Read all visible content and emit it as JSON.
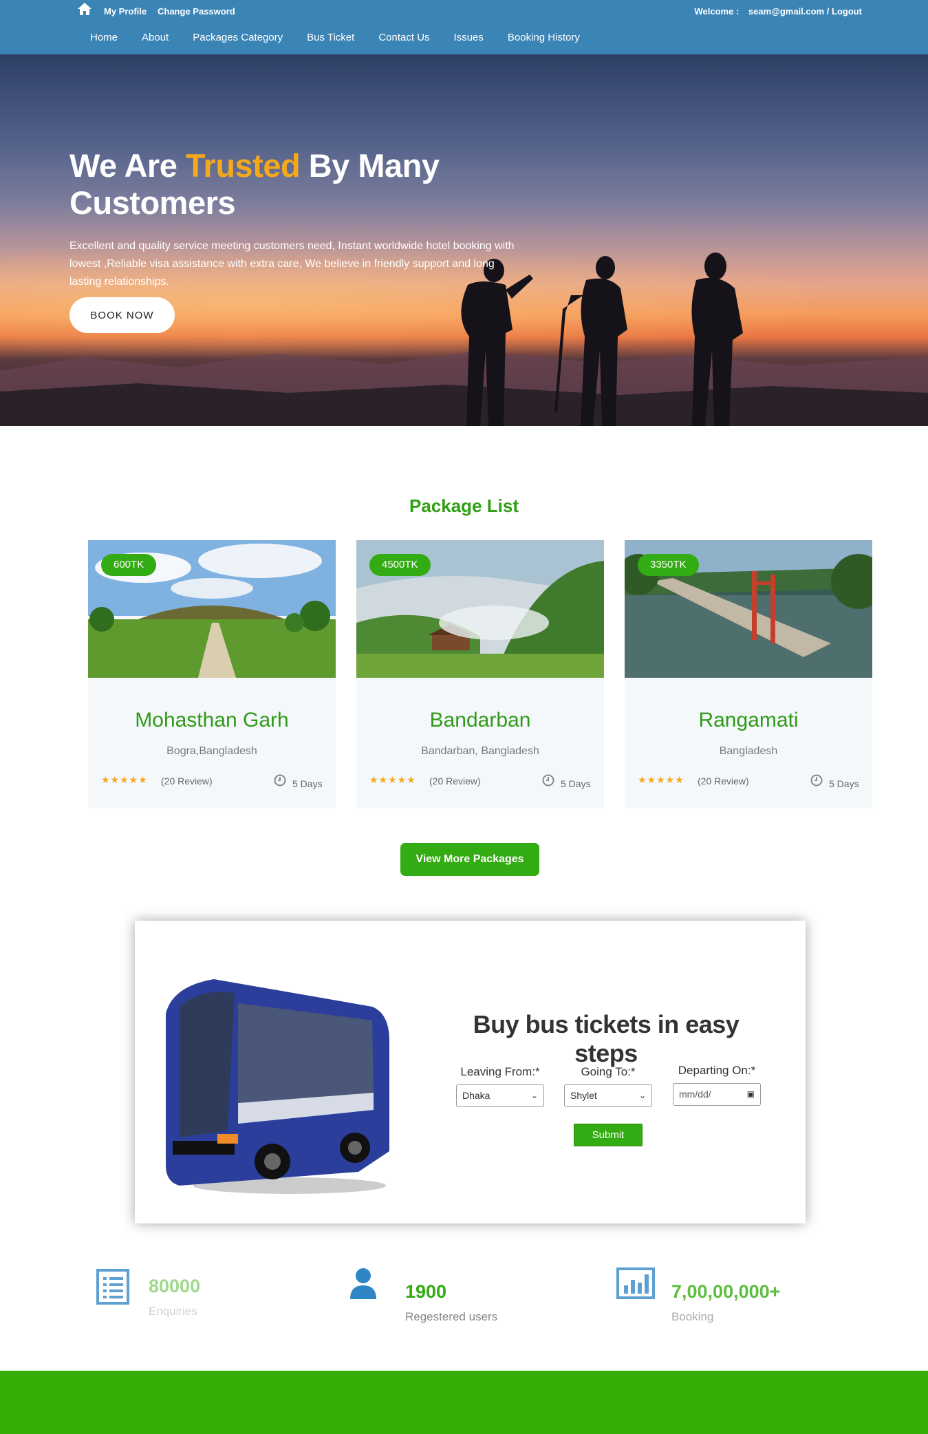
{
  "header": {
    "top_links": [
      "My Profile",
      "Change Password"
    ],
    "welcome_label": "Welcome :",
    "welcome_user": "seam@gmail.com / Logout",
    "nav": [
      "Home",
      "About",
      "Packages Category",
      "Bus Ticket",
      "Contact Us",
      "Issues",
      "Booking History"
    ]
  },
  "hero": {
    "title_part1": "We Are ",
    "title_accent": "Trusted",
    "title_part2": " By Many Customers",
    "description": "Excellent and quality service meeting customers need, Instant worldwide hotel booking with lowest ,Reliable visa assistance with extra care, We believe in friendly support and long lasting relationships.",
    "button": "BOOK NOW"
  },
  "packages": {
    "title": "Package List",
    "items": [
      {
        "price": "600TK",
        "name": "Mohasthan Garh",
        "location": "Bogra,Bangladesh",
        "stars": "★★★★★",
        "reviews": "(20 Review)",
        "duration": "5 Days"
      },
      {
        "price": "4500TK",
        "name": "Bandarban",
        "location": "Bandarban, Bangladesh",
        "stars": "★★★★★",
        "reviews": "(20 Review)",
        "duration": "5 Days"
      },
      {
        "price": "3350TK",
        "name": "Rangamati",
        "location": "Bangladesh",
        "stars": "★★★★★",
        "reviews": "(20 Review)",
        "duration": "5 Days"
      }
    ],
    "more_button": "View More Packages"
  },
  "bus": {
    "title": "Buy bus tickets in easy steps",
    "leaving_label": "Leaving From:*",
    "leaving_value": "Dhaka",
    "going_label": "Going To:*",
    "going_value": "Shylet",
    "date_label": "Departing On:*",
    "date_placeholder": "mm/dd/",
    "submit": "Submit"
  },
  "stats": [
    {
      "value": "80000",
      "label": "Enquiries",
      "icon": "list-icon",
      "color": "#9fd98a"
    },
    {
      "value": "1900",
      "label": "Regestered users",
      "icon": "user-icon",
      "color": "#33ab12"
    },
    {
      "value": "7,00,00,000+",
      "label": "Booking",
      "icon": "bar-chart-icon",
      "color": "#5cbf3f"
    }
  ],
  "colors": {
    "brand_blue": "#3b84b6",
    "brand_green": "#33ab12",
    "accent_orange": "#f6a81c"
  }
}
